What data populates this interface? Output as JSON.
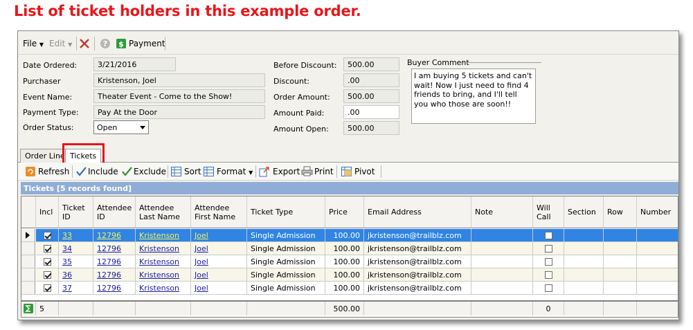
{
  "caption": "List of ticket holders in this example order.",
  "menu": {
    "file": "File",
    "edit": "Edit",
    "payment": "Payment"
  },
  "form": {
    "date_label": "Date Ordered:",
    "date": "3/21/2016",
    "purchaser_label": "Purchaser",
    "purchaser": "Kristenson, Joel",
    "event_label": "Event Name:",
    "event": "Theater Event - Come to the Show!",
    "payment_type_label": "Payment Type:",
    "payment_type": "Pay At the Door",
    "status_label": "Order Status:",
    "status": "Open",
    "before_discount_label": "Before Discount:",
    "before_discount": "500.00",
    "discount_label": "Discount:",
    "discount": ".00",
    "order_amount_label": "Order Amount:",
    "order_amount": "500.00",
    "amount_paid_label": "Amount Paid:",
    "amount_paid": ".00",
    "amount_open_label": "Amount Open:",
    "amount_open": "500.00",
    "buyer_comment_label": "Buyer Comment",
    "buyer_comment": "I am buying 5 tickets and can't wait!  Now I just need to find 4 friends to bring, and I'll tell you who those are soon!!"
  },
  "tabs": {
    "order_lines": "Order Lines",
    "tickets": "Tickets"
  },
  "toolbar": {
    "refresh": "Refresh",
    "include": "Include",
    "exclude": "Exclude",
    "sort": "Sort",
    "format": "Format",
    "export": "Export",
    "print": "Print",
    "pivot": "Pivot"
  },
  "grid": {
    "title": "Tickets [5 records found]",
    "headers": {
      "incl": "Incl",
      "ticket_id": "Ticket ID",
      "attendee_id": "Attendee ID",
      "last": "Attendee Last Name",
      "first": "Attendee First Name",
      "type": "Ticket Type",
      "price": "Price",
      "email": "Email Address",
      "note": "Note",
      "will_call": "Will Call",
      "section": "Section",
      "row": "Row",
      "number": "Number"
    },
    "rows": [
      {
        "incl": true,
        "ticket_id": "33",
        "attendee_id": "12796",
        "last": "Kristenson",
        "first": "Joel",
        "type": "Single Admission",
        "price": "100.00",
        "email": "jkristenson@trailblz.com",
        "will_call": false
      },
      {
        "incl": true,
        "ticket_id": "34",
        "attendee_id": "12796",
        "last": "Kristenson",
        "first": "Joel",
        "type": "Single Admission",
        "price": "100.00",
        "email": "jkristenson@trailblz.com",
        "will_call": false
      },
      {
        "incl": true,
        "ticket_id": "35",
        "attendee_id": "12796",
        "last": "Kristenson",
        "first": "Joel",
        "type": "Single Admission",
        "price": "100.00",
        "email": "jkristenson@trailblz.com",
        "will_call": false
      },
      {
        "incl": true,
        "ticket_id": "36",
        "attendee_id": "12796",
        "last": "Kristenson",
        "first": "Joel",
        "type": "Single Admission",
        "price": "100.00",
        "email": "jkristenson@trailblz.com",
        "will_call": false
      },
      {
        "incl": true,
        "ticket_id": "37",
        "attendee_id": "12796",
        "last": "Kristenson",
        "first": "Joel",
        "type": "Single Admission",
        "price": "100.00",
        "email": "jkristenson@trailblz.com",
        "will_call": false
      }
    ],
    "footer": {
      "count": "5",
      "price_total": "500.00",
      "will_call_total": "0"
    }
  },
  "colors": {
    "caption": "#e8161b",
    "selected_row": "#2f84e4",
    "grid_title": "#8fadd6",
    "highlight_box": "#e5161c"
  },
  "icons": [
    "dropdown-arrow-icon",
    "close-x-icon",
    "help-icon",
    "payment-dollar-icon",
    "refresh-icon",
    "include-check-icon",
    "exclude-check-icon",
    "sort-icon",
    "format-icon",
    "export-icon",
    "print-icon",
    "pivot-icon",
    "row-pointer-icon",
    "sum-icon"
  ]
}
